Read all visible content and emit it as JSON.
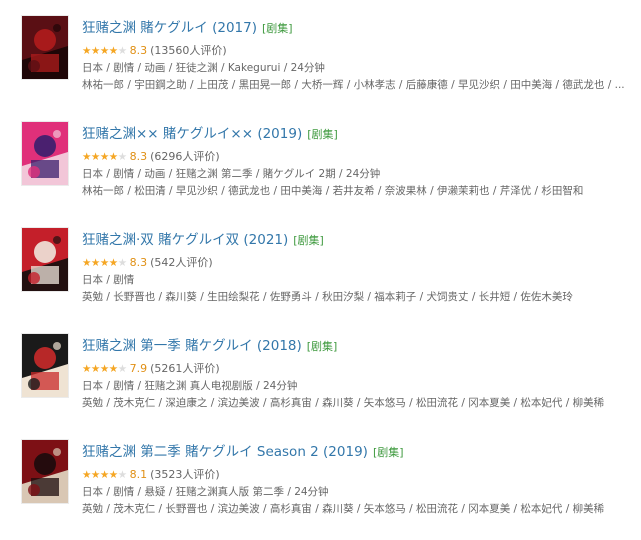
{
  "results": [
    {
      "title": "狂赌之渊 賭ケグルイ (2017)",
      "tag": "[剧集]",
      "stars": 4,
      "score": "8.3",
      "votes": "(13560人评价)",
      "meta": "日本 / 剧情 / 动画 / 狂徒之渊 / Kakegurui / 24分钟",
      "cast": "林祐一郎 / 宇田鋼之助 / 上田茂 / 黒田晃一郎 / 大桥一辉 / 小林孝志 / 后藤康德 / 早见沙织 / 田中美海 / 德武龙也 / ...",
      "poster_colors": [
        "#5a0f14",
        "#b01c1c",
        "#1e0607"
      ]
    },
    {
      "title": "狂赌之渊×× 賭ケグルイ×× (2019)",
      "tag": "[剧集]",
      "stars": 4,
      "score": "8.3",
      "votes": "(6296人评价)",
      "meta": "日本 / 剧情 / 动画 / 狂赌之渊 第二季 / 賭ケグルイ 2期 / 24分钟",
      "cast": "林祐一郎 / 松田清 / 早见沙织 / 德武龙也 / 田中美海 / 若井友希 / 奈波果林 / 伊濑茉莉也 / 芹泽优 / 杉田智和",
      "poster_colors": [
        "#e0307a",
        "#3a1f6e",
        "#f2c6d8"
      ]
    },
    {
      "title": "狂赌之渊·双 賭ケグルイ双 (2021)",
      "tag": "[剧集]",
      "stars": 4,
      "score": "8.3",
      "votes": "(542人评价)",
      "meta": "日本 / 剧情",
      "cast": "英勉 / 长野晋也 / 森川葵 / 生田绘梨花 / 佐野勇斗 / 秋田汐梨 / 福本莉子 / 犬饲贵丈 / 长井短 / 佐佐木美玲",
      "poster_colors": [
        "#c41f2a",
        "#f0e6dc",
        "#221010"
      ]
    },
    {
      "title": "狂赌之渊 第一季 賭ケグルイ (2018)",
      "tag": "[剧集]",
      "stars": 4,
      "score": "7.9",
      "votes": "(5261人评价)",
      "meta": "日本 / 剧情 / 狂赌之渊 真人电视剧版 / 24分钟",
      "cast": "英勉 / 茂木克仁 / 深迫康之 / 滨边美波 / 高杉真宙 / 森川葵 / 矢本悠马 / 松田流花 / 冈本夏美 / 松本妃代 / 柳美稀",
      "poster_colors": [
        "#1a1a1a",
        "#c92a2a",
        "#efe3d3"
      ]
    },
    {
      "title": "狂赌之渊 第二季 賭ケグルイ Season 2 (2019)",
      "tag": "[剧集]",
      "stars": 4,
      "score": "8.1",
      "votes": "(3523人评价)",
      "meta": "日本 / 剧情 / 悬疑 / 狂赌之渊真人版 第二季 / 24分钟",
      "cast": "英勉 / 茂木克仁 / 长野晋也 / 滨边美波 / 高杉真宙 / 森川葵 / 矢本悠马 / 松田流花 / 冈本夏美 / 松本妃代 / 柳美稀",
      "poster_colors": [
        "#7d1015",
        "#1b0b0c",
        "#d9c7b4"
      ]
    }
  ]
}
